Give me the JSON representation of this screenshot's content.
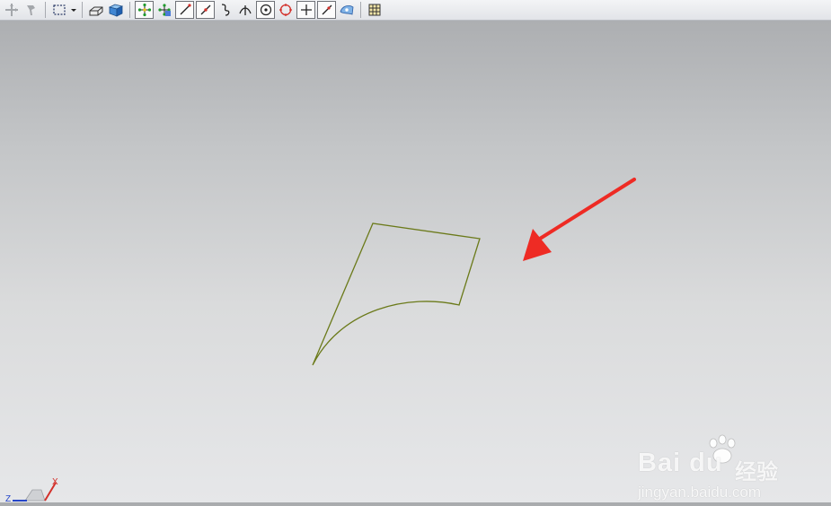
{
  "toolbar": {
    "buttons": [
      {
        "name": "move-icon",
        "enabled": false
      },
      {
        "name": "paint-brush-icon",
        "enabled": false
      },
      {
        "name": "selection-rectangle-icon",
        "enabled": true
      },
      {
        "name": "dropdown-arrow-icon",
        "enabled": true
      },
      {
        "name": "wireframe-view-icon",
        "enabled": true
      },
      {
        "name": "shaded-cube-icon",
        "enabled": true
      },
      {
        "name": "snap-points-icon",
        "enabled": true
      },
      {
        "name": "snap-settings-icon",
        "enabled": true
      },
      {
        "name": "endpoint-snap-icon",
        "enabled": true
      },
      {
        "name": "midpoint-snap-icon",
        "enabled": true
      },
      {
        "name": "control-point-icon",
        "enabled": true
      },
      {
        "name": "intersection-icon",
        "enabled": true
      },
      {
        "name": "arc-center-icon",
        "enabled": true
      },
      {
        "name": "quadrant-point-icon",
        "enabled": true
      },
      {
        "name": "existing-point-icon",
        "enabled": true
      },
      {
        "name": "point-on-curve-icon",
        "enabled": true
      },
      {
        "name": "point-on-face-icon",
        "enabled": true
      },
      {
        "name": "grid-icon",
        "enabled": true
      }
    ]
  },
  "viewport": {
    "geometry_color": "#6b7a1a",
    "annotation_arrow_color": "#ee2b24"
  },
  "triad": {
    "x_label": "X",
    "z_label": "Z"
  },
  "watermark": {
    "brand": "Bai du",
    "brand_cn": "经验",
    "url": "jingyan.baidu.com"
  }
}
